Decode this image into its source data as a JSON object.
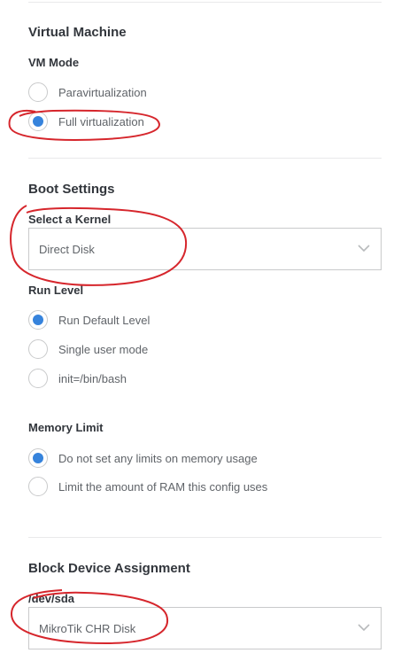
{
  "virtual_machine": {
    "title": "Virtual Machine",
    "vm_mode": {
      "label": "VM Mode",
      "options": [
        {
          "label": "Paravirtualization",
          "checked": false
        },
        {
          "label": "Full virtualization",
          "checked": true
        }
      ]
    }
  },
  "boot_settings": {
    "title": "Boot Settings",
    "kernel": {
      "label": "Select a Kernel",
      "value": "Direct Disk"
    },
    "run_level": {
      "label": "Run Level",
      "options": [
        {
          "label": "Run Default Level",
          "checked": true
        },
        {
          "label": "Single user mode",
          "checked": false
        },
        {
          "label": "init=/bin/bash",
          "checked": false
        }
      ]
    },
    "memory_limit": {
      "label": "Memory Limit",
      "options": [
        {
          "label": "Do not set any limits on memory usage",
          "checked": true
        },
        {
          "label": "Limit the amount of RAM this config uses",
          "checked": false
        }
      ]
    }
  },
  "block_device_assignment": {
    "title": "Block Device Assignment",
    "sda": {
      "label": "/dev/sda",
      "value": "MikroTik CHR Disk"
    }
  },
  "icons": {
    "select_arrow": "chevron-down-icon"
  },
  "colors": {
    "accent": "#3683dc",
    "annotation": "#d6262c"
  }
}
